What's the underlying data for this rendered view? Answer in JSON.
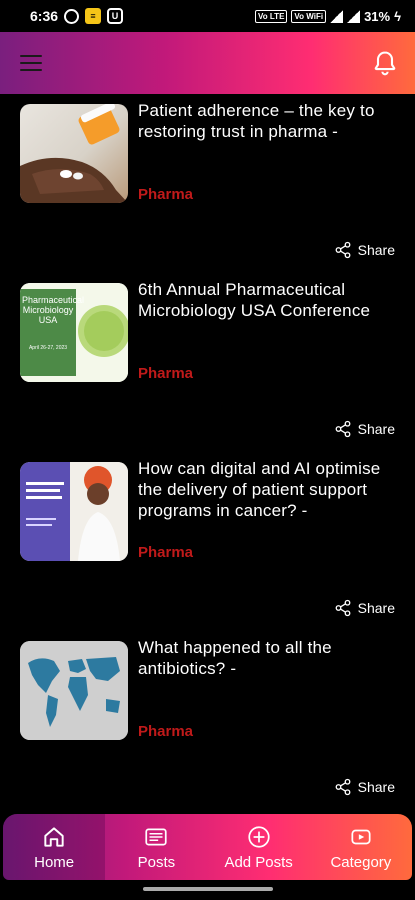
{
  "status": {
    "time": "6:36",
    "battery": "31%",
    "net1": "Vo LTE",
    "net2": "Vo WiFi"
  },
  "icons": {
    "menu": "menu-icon",
    "bell": "bell-icon",
    "share": "share-icon",
    "home": "home-icon",
    "posts": "posts-icon",
    "add": "add-circle-icon",
    "category": "play-icon"
  },
  "colors": {
    "category": "#c01a1a",
    "gradient_start": "#7a1f7e",
    "gradient_end": "#ff6a3d"
  },
  "posts": [
    {
      "title": "Patient adherence – the key to restoring trust in pharma -",
      "category": "Pharma",
      "share": "Share"
    },
    {
      "title": "6th Annual Pharmaceutical Microbiology USA Conference",
      "category": "Pharma",
      "share": "Share",
      "thumb_text": "Pharmaceutical Microbiology USA"
    },
    {
      "title": "How can digital and AI optimise the delivery of patient support programs in cancer? -",
      "category": "Pharma",
      "share": "Share"
    },
    {
      "title": "What happened to all the antibiotics? -",
      "category": "Pharma",
      "share": "Share"
    }
  ],
  "nav": {
    "home": "Home",
    "posts": "Posts",
    "add_posts": "Add Posts",
    "category": "Category"
  }
}
